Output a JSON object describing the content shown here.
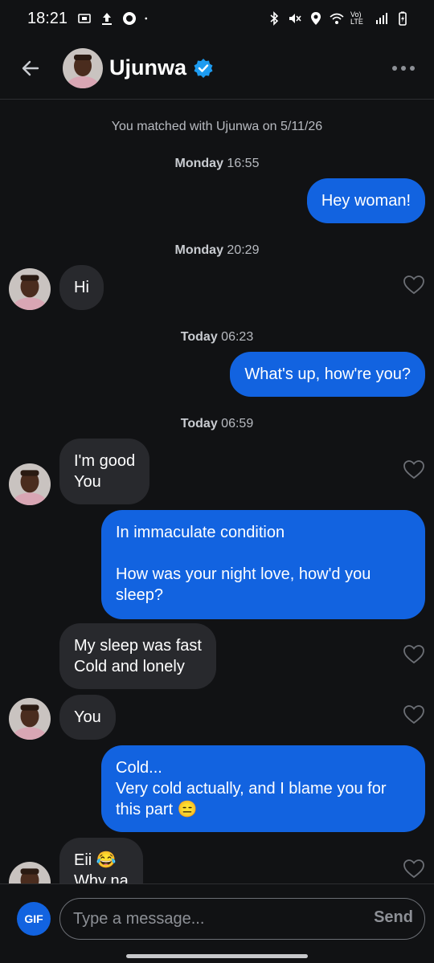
{
  "status_bar": {
    "time": "18:21",
    "left_icons": [
      "screenshot-icon",
      "upload-icon",
      "app-icon",
      "dot-icon"
    ],
    "right_icons": [
      "bluetooth-icon",
      "mute-icon",
      "location-icon",
      "wifi-icon",
      "volte-icon",
      "signal-icon",
      "battery-icon"
    ],
    "volte_text": "Vo) LTE"
  },
  "header": {
    "name": "Ujunwa",
    "verified": true,
    "accent": "#1d9bf0"
  },
  "chat": {
    "match_notice": "You matched with Ujunwa on 5/11/26",
    "timestamps": [
      {
        "day": "Monday",
        "time": "16:55"
      },
      {
        "day": "Monday",
        "time": "20:29"
      },
      {
        "day": "Today",
        "time": "06:23"
      },
      {
        "day": "Today",
        "time": "06:59"
      }
    ],
    "messages": [
      {
        "from": "me",
        "text": "Hey woman!"
      },
      {
        "from": "them",
        "text": "Hi"
      },
      {
        "from": "me",
        "text": "What's up, how're you?"
      },
      {
        "from": "them",
        "text": "I'm good\nYou"
      },
      {
        "from": "me",
        "text": "In immaculate condition\n\nHow was your night love, how'd you sleep?"
      },
      {
        "from": "them",
        "text": "My sleep was fast\nCold and lonely"
      },
      {
        "from": "them",
        "text": "You"
      },
      {
        "from": "me",
        "text": "Cold...\nVery cold actually, and I blame you for this part 😑"
      },
      {
        "from": "them",
        "text": "Eii 😂\nWhy na"
      }
    ]
  },
  "composer": {
    "gif_label": "GIF",
    "placeholder": "Type a message...",
    "send_label": "Send"
  },
  "colors": {
    "background": "#111214",
    "outgoing_bubble": "#1263e0",
    "incoming_bubble": "#28292d"
  }
}
